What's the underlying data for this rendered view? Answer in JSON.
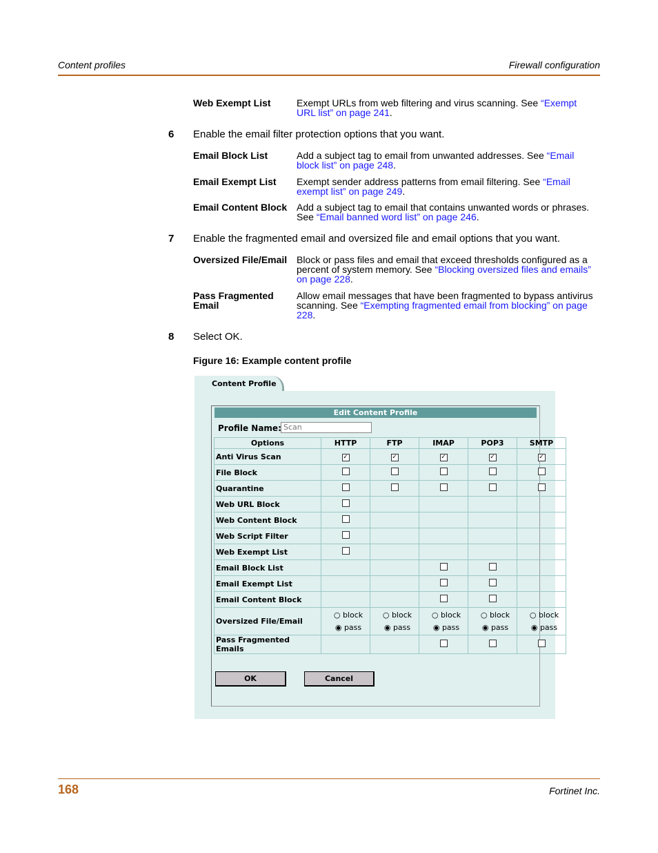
{
  "header": {
    "left": "Content profiles",
    "right": "Firewall configuration"
  },
  "defs1": [
    {
      "term": "Web Exempt List",
      "text": "Exempt URLs from web filtering and virus scanning. See ",
      "link": "“Exempt URL list” on page 241",
      "end": "."
    }
  ],
  "step6": {
    "num": "6",
    "text": "Enable the email filter protection options that you want."
  },
  "defs2": [
    {
      "term": "Email Block List",
      "text": "Add a subject tag to email from unwanted addresses. See ",
      "link": "“Email block list” on page 248",
      "end": "."
    },
    {
      "term": "Email Exempt List",
      "text": "Exempt sender address patterns from email filtering. See ",
      "link": "“Email exempt list” on page 249",
      "end": "."
    },
    {
      "term": "Email Content Block",
      "text": "Add a subject tag to email that contains unwanted words or phrases. See ",
      "link": "“Email banned word list” on page 246",
      "end": "."
    }
  ],
  "step7": {
    "num": "7",
    "text": "Enable the fragmented email and oversized file and email options that you want."
  },
  "defs3": [
    {
      "term": "Oversized File/Email",
      "text": "Block or pass files and email that exceed thresholds configured as a percent of system memory. See ",
      "link": "“Blocking oversized files and emails” on page 228",
      "end": "."
    },
    {
      "term": "Pass Fragmented Email",
      "text": "Allow email messages that have been fragmented to bypass antivirus scanning. See ",
      "link": "“Exempting fragmented email from blocking” on page 228",
      "end": "."
    }
  ],
  "step8": {
    "num": "8",
    "text": "Select OK."
  },
  "figure": "Figure 16: Example content profile",
  "ui": {
    "tab": "Content Profile",
    "title": "Edit Content Profile",
    "profile_label": "Profile Name:",
    "profile_value": "Scan",
    "cols": [
      "Options",
      "HTTP",
      "FTP",
      "IMAP",
      "POP3",
      "SMTP"
    ],
    "rows": [
      {
        "label": "Anti Virus Scan",
        "cells": [
          "on",
          "on",
          "on",
          "on",
          "on"
        ]
      },
      {
        "label": "File Block",
        "cells": [
          "off",
          "off",
          "off",
          "off",
          "off"
        ]
      },
      {
        "label": "Quarantine",
        "cells": [
          "off",
          "off",
          "off",
          "off",
          "off"
        ]
      },
      {
        "label": "Web URL Block",
        "cells": [
          "off",
          "",
          "",
          "",
          ""
        ]
      },
      {
        "label": "Web Content Block",
        "cells": [
          "off",
          "",
          "",
          "",
          ""
        ]
      },
      {
        "label": "Web Script Filter",
        "cells": [
          "off",
          "",
          "",
          "",
          ""
        ]
      },
      {
        "label": "Web Exempt List",
        "cells": [
          "off",
          "",
          "",
          "",
          ""
        ]
      },
      {
        "label": "Email Block List",
        "cells": [
          "",
          "",
          "off",
          "off",
          ""
        ]
      },
      {
        "label": "Email Exempt List",
        "cells": [
          "",
          "",
          "off",
          "off",
          ""
        ]
      },
      {
        "label": "Email Content Block",
        "cells": [
          "",
          "",
          "off",
          "off",
          ""
        ]
      },
      {
        "label": "Oversized File/Email",
        "cells": [
          "radio",
          "radio",
          "radio",
          "radio",
          "radio"
        ]
      },
      {
        "label": "Pass Fragmented Emails",
        "cells": [
          "",
          "",
          "off",
          "off",
          "off"
        ]
      }
    ],
    "radio_block": "block",
    "radio_pass": "pass",
    "ok": "OK",
    "cancel": "Cancel"
  },
  "footer": {
    "page": "168",
    "company": "Fortinet Inc."
  }
}
